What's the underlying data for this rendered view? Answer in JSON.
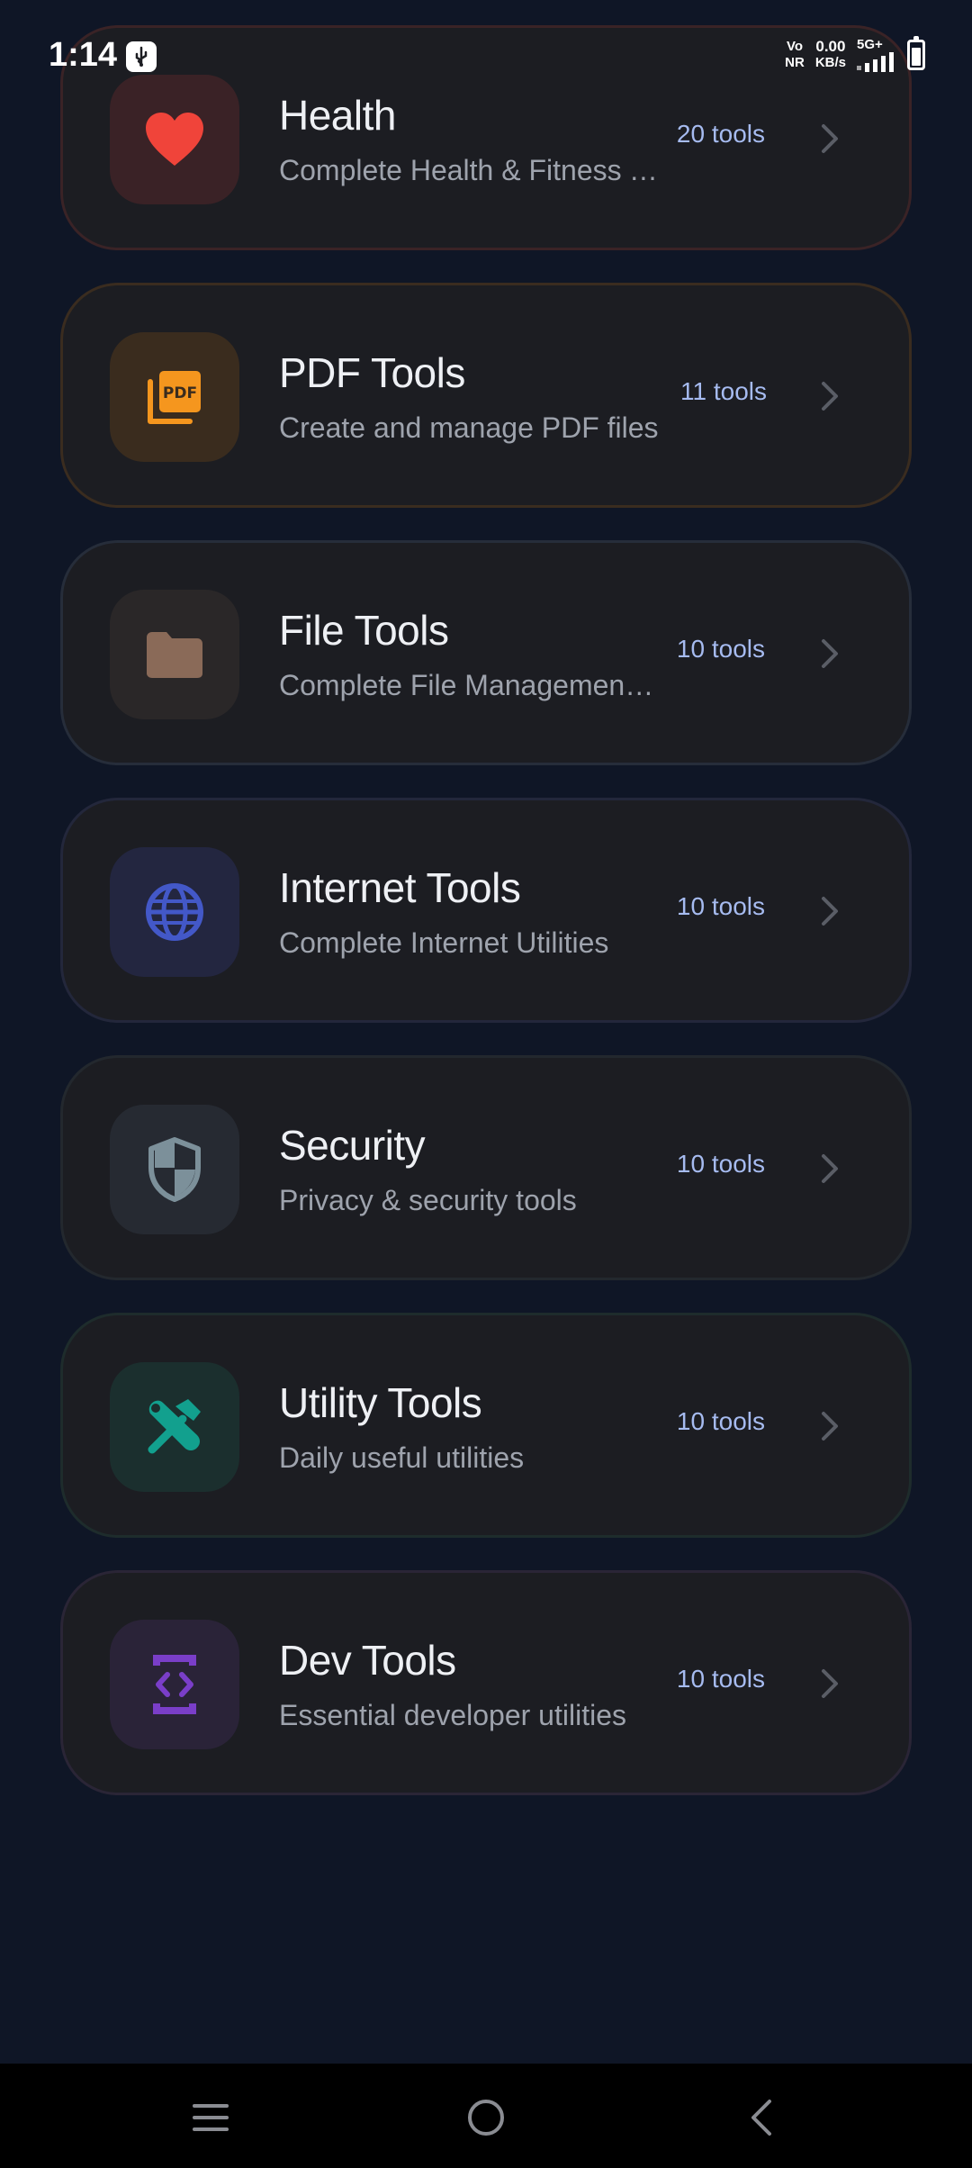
{
  "status_bar": {
    "time": "1:14",
    "volte_top": "Vo",
    "volte_bottom": "NR",
    "speed_value": "0.00",
    "speed_unit": "KB/s",
    "network": "5G+",
    "battery_level": 0.7
  },
  "categories": [
    {
      "key": "health",
      "title": "Health",
      "subtitle": "Complete Health & Fitness Tools",
      "count": "20 tools",
      "icon": "heart-icon",
      "tile_color": "#3a2226",
      "icon_color": "#f0443a"
    },
    {
      "key": "pdf",
      "title": "PDF Tools",
      "subtitle": "Create and manage PDF files",
      "count": "11 tools",
      "icon": "pdf-icon",
      "tile_color": "#3a2c1e",
      "icon_color": "#f5961e",
      "icon_text": "PDF"
    },
    {
      "key": "file",
      "title": "File Tools",
      "subtitle": "Complete File Management Tools",
      "count": "10 tools",
      "icon": "folder-icon",
      "tile_color": "#2a2728",
      "icon_color": "#8a6a58"
    },
    {
      "key": "internet",
      "title": "Internet Tools",
      "subtitle": "Complete Internet Utilities",
      "count": "10 tools",
      "icon": "globe-icon",
      "tile_color": "#232640",
      "icon_color": "#4358c8"
    },
    {
      "key": "security",
      "title": "Security",
      "subtitle": "Privacy & security tools",
      "count": "10 tools",
      "icon": "shield-icon",
      "tile_color": "#262a32",
      "icon_color": "#7c909a"
    },
    {
      "key": "utility",
      "title": "Utility Tools",
      "subtitle": "Daily useful utilities",
      "count": "10 tools",
      "icon": "tools-icon",
      "tile_color": "#1b2f2e",
      "icon_color": "#12a08e"
    },
    {
      "key": "dev",
      "title": "Dev Tools",
      "subtitle": "Essential developer utilities",
      "count": "10 tools",
      "icon": "code-icon",
      "tile_color": "#2a2338",
      "icon_color": "#7a3ec8"
    }
  ],
  "colors": {
    "background": "#0f1626",
    "card": "#1c1d22",
    "count_text": "#a6bbf0",
    "subtitle_text": "#9ea3ad"
  }
}
